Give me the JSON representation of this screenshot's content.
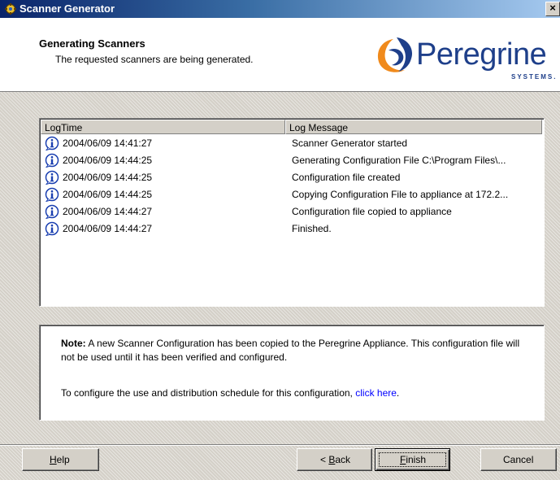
{
  "window": {
    "title": "Scanner Generator",
    "close_glyph": "×"
  },
  "header": {
    "title": "Generating Scanners",
    "subtitle": "The requested scanners are being generated.",
    "logo_text": "Peregrine",
    "logo_subtext": "SYSTEMS."
  },
  "log": {
    "columns": [
      "LogTime",
      "Log Message"
    ],
    "rows": [
      {
        "time": "2004/06/09 14:41:27",
        "message": "Scanner Generator started"
      },
      {
        "time": "2004/06/09 14:44:25",
        "message": "Generating Configuration File C:\\Program Files\\..."
      },
      {
        "time": "2004/06/09 14:44:25",
        "message": "Configuration file created"
      },
      {
        "time": "2004/06/09 14:44:25",
        "message": "Copying Configuration File to appliance at 172.2..."
      },
      {
        "time": "2004/06/09 14:44:27",
        "message": "Configuration file copied to appliance"
      },
      {
        "time": "2004/06/09 14:44:27",
        "message": "Finished."
      }
    ],
    "row_icon": "info-icon"
  },
  "note": {
    "label": "Note:",
    "text": " A new Scanner Configuration has been copied to the Peregrine Appliance. This configuration file will not be used until it has been verified and configured.",
    "schedule_text": "To configure the use and distribution schedule for this configuration, ",
    "link_text": "click here",
    "after_link": "."
  },
  "buttons": {
    "help": {
      "pre": "",
      "key": "H",
      "post": "elp"
    },
    "back": {
      "pre": "< ",
      "key": "B",
      "post": "ack"
    },
    "finish": {
      "pre": "",
      "key": "F",
      "post": "inish"
    },
    "cancel": "Cancel"
  },
  "colors": {
    "brand": "#1e3f8a",
    "accent_orange": "#f08a1c",
    "titlebar": "#0a246a",
    "link": "#0000ff"
  }
}
